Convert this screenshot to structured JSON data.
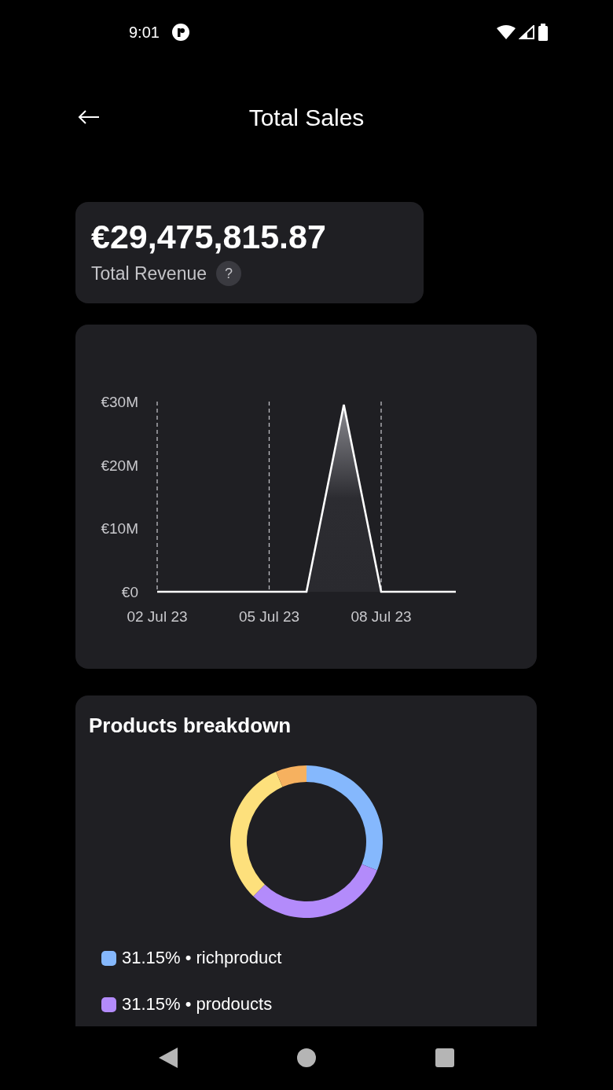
{
  "status_bar": {
    "time": "9:01"
  },
  "header": {
    "title": "Total Sales"
  },
  "revenue": {
    "amount": "€29,475,815.87",
    "label": "Total Revenue",
    "help": "?"
  },
  "sales_chart": {
    "chart_data": {
      "type": "area",
      "categories": [
        "02 Jul 23",
        null,
        null,
        "05 Jul 23",
        null,
        null,
        "08 Jul 23",
        null,
        null
      ],
      "grid": true,
      "series": [
        {
          "color": "#ffffff",
          "values": [
            0,
            0,
            0,
            0,
            0,
            29.5,
            0,
            0,
            0
          ]
        }
      ],
      "ylim": [
        0,
        30
      ],
      "yticks": [
        {
          "value": 0,
          "label": "€0"
        },
        {
          "value": 10,
          "label": "€10M"
        },
        {
          "value": 20,
          "label": "€20M"
        },
        {
          "value": 30,
          "label": "€30M"
        }
      ]
    }
  },
  "breakdown": {
    "title": "Products breakdown",
    "chart_data": {
      "type": "donut",
      "values": [
        31.15,
        31.15,
        31.15,
        6.55
      ],
      "colors": [
        "#85b8fd",
        "#b38bfb",
        "#fde07c",
        "#f6b15f"
      ]
    },
    "legend": [
      {
        "text": "31.15% • richproduct",
        "color": "#85b8fd"
      },
      {
        "text": "31.15% • prodoucts",
        "color": "#b38bfb"
      }
    ]
  }
}
